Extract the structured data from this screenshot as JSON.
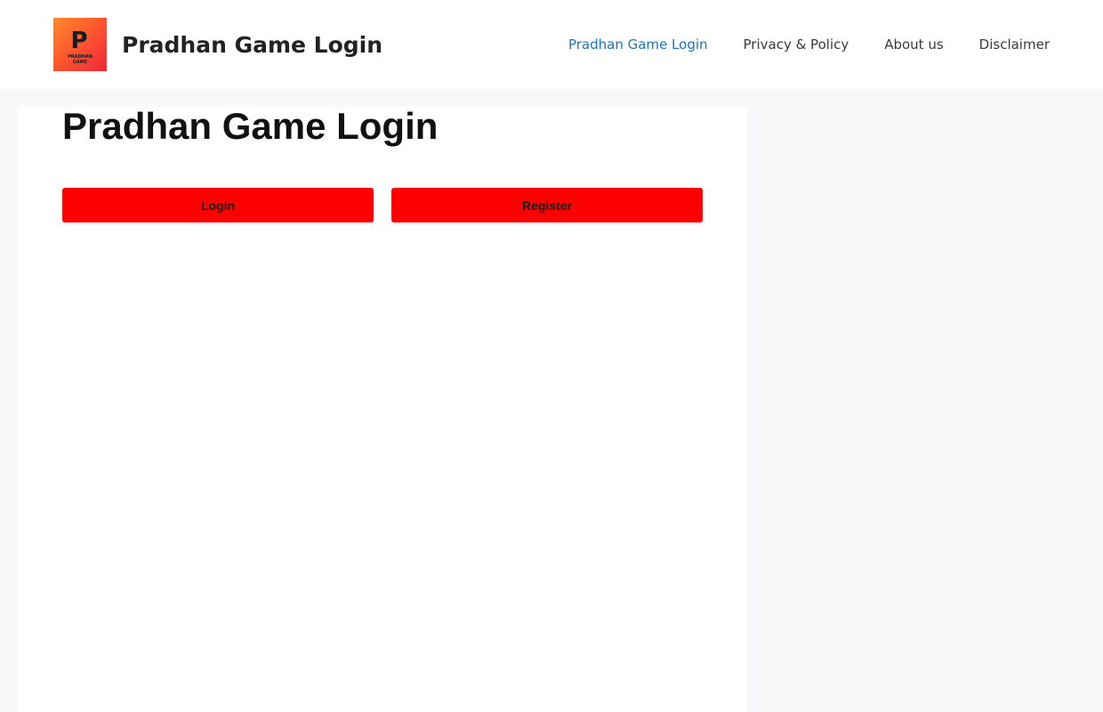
{
  "header": {
    "site_title": "Pradhan Game Login",
    "logo": {
      "icon": "pradhan-game-logo",
      "letter": "P",
      "caption_line1": "PRADHAN",
      "caption_line2": "GAME",
      "colors": [
        "#ff8a2a",
        "#f0283c"
      ]
    },
    "nav": [
      {
        "label": "Pradhan Game Login",
        "current": true
      },
      {
        "label": "Privacy & Policy",
        "current": false
      },
      {
        "label": "About us",
        "current": false
      },
      {
        "label": "Disclaimer",
        "current": false
      }
    ]
  },
  "main": {
    "title": "Pradhan Game Login",
    "buttons": {
      "login_label": "Login",
      "register_label": "Register"
    }
  },
  "colors": {
    "accent_link": "#1e73be",
    "button_bg": "#ff0000",
    "page_bg": "#f7f8f9"
  }
}
